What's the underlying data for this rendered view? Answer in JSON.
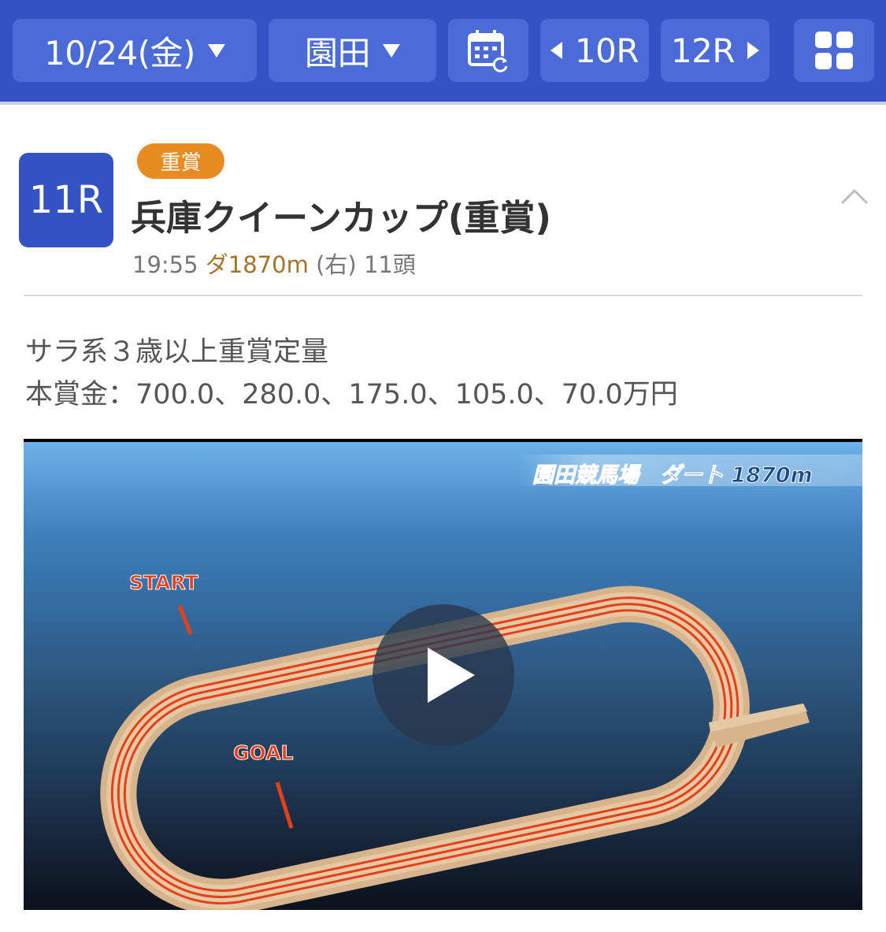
{
  "header": {
    "date": "10/24(金)",
    "venue": "園田",
    "prev_race": "10R",
    "next_race": "12R",
    "icons": [
      "calendar-refresh-icon",
      "grid-menu-icon"
    ]
  },
  "race": {
    "number": "11R",
    "grade": "重賞",
    "title": "兵庫クイーンカップ(重賞)",
    "time": "19:55",
    "distance": "ダ1870m",
    "direction": "(右)",
    "runners": "11頭",
    "conditions": "サラ系３歳以上重賞定量",
    "prize": "本賞金：700.0、280.0、175.0、105.0、70.0万円"
  },
  "video": {
    "caption": "園田競馬場　ダート 1870m",
    "start_label": "START",
    "goal_label": "GOAL"
  },
  "colors": {
    "header_bg": "#3352c4",
    "button_bg": "#4a6bd8",
    "grade_badge": "#e88b21",
    "distance_text": "#a5732a"
  }
}
